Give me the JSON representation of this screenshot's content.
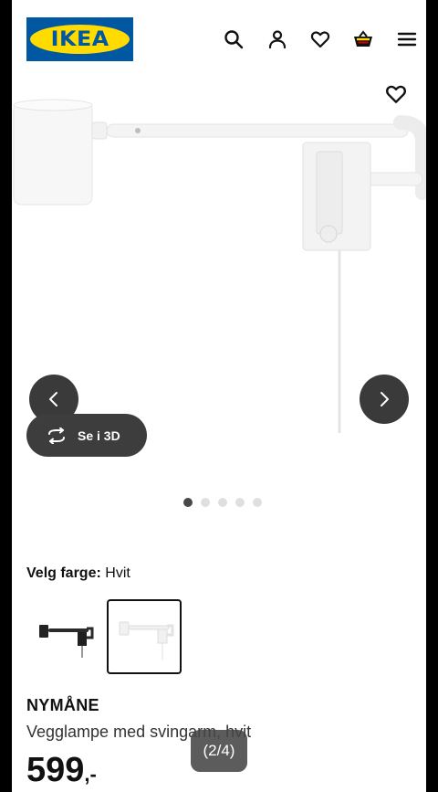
{
  "header": {
    "logo_text": "IKEA",
    "brand_blue": "#0058a3",
    "brand_yellow": "#ffdb00",
    "icons": [
      "search-icon",
      "user-icon",
      "heart-icon",
      "basket-icon",
      "menu-icon"
    ]
  },
  "gallery": {
    "view_3d_label": "Se i 3D",
    "dots_total": 5,
    "dots_active_index": 0,
    "counter": "(2/4)"
  },
  "color": {
    "label": "Velg farge:",
    "value": "Hvit",
    "swatches": [
      "black-lamp",
      "white-lamp"
    ],
    "selected_index": 1
  },
  "product": {
    "name": "NYMÅNE",
    "description": "Vegglampe med svingarm, hvit",
    "price": "599",
    "price_suffix": ",-"
  }
}
